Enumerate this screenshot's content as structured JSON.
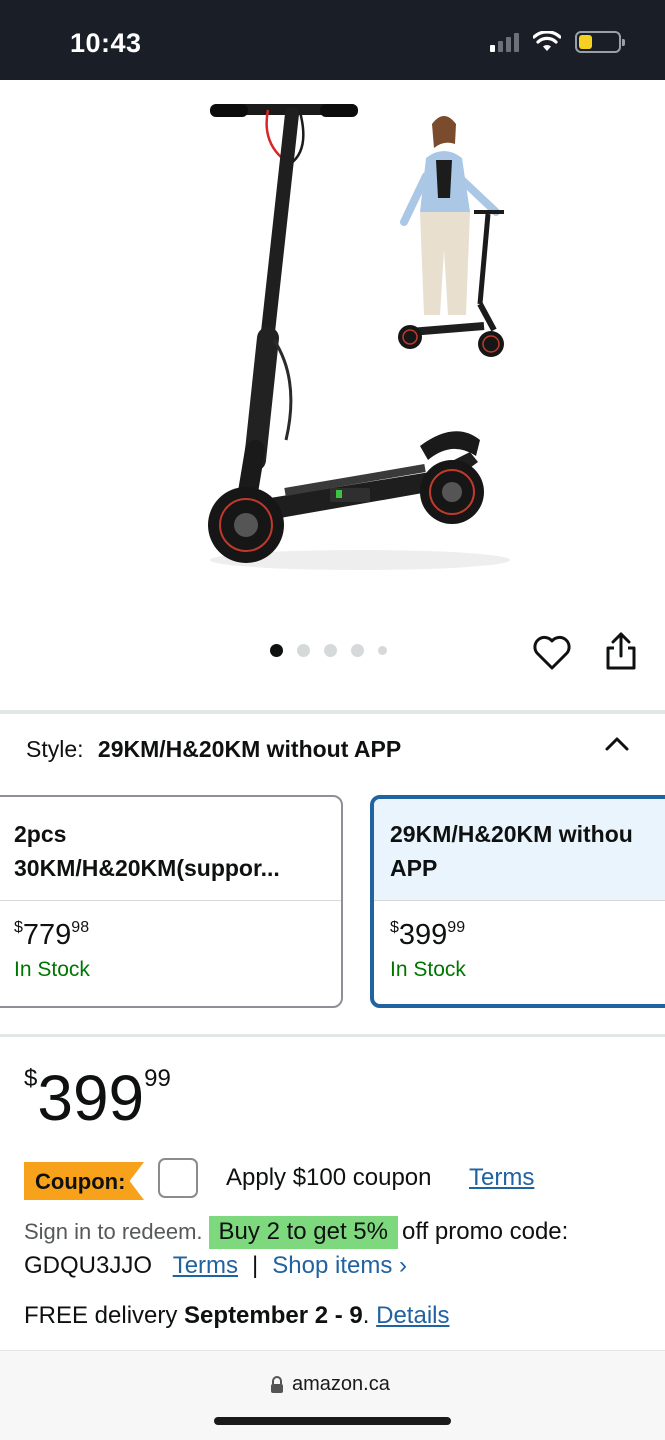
{
  "status_bar": {
    "time": "10:43",
    "icons": [
      "cellular-signal-icon",
      "wifi-icon",
      "battery-icon"
    ],
    "battery_level": 0.35,
    "battery_color": "#f5d21f"
  },
  "gallery": {
    "image": "electric-scooter-product-photo",
    "dots_total": 5,
    "active_dot": 1,
    "icons": [
      "heart-icon",
      "share-icon"
    ]
  },
  "style": {
    "label": "Style:",
    "value": "29KM/H&20KM without APP",
    "toggle_icon": "chevron-up-icon"
  },
  "swatches": [
    {
      "title_line1": "2pcs",
      "title_line2": "30KM/H&20KM(suppor...",
      "currency": "$",
      "whole": "779",
      "fraction": "98",
      "stock": "In Stock",
      "selected": false
    },
    {
      "title_line1": "29KM/H&20KM withou",
      "title_line2": "APP",
      "currency": "$",
      "whole": "399",
      "fraction": "99",
      "stock": "In Stock",
      "selected": true
    }
  ],
  "price": {
    "currency": "$",
    "whole": "399",
    "fraction": "99"
  },
  "coupon": {
    "badge": "Coupon:",
    "apply_text": "Apply $100 coupon",
    "terms": "Terms"
  },
  "promo": {
    "sign_in": "Sign in to redeem.",
    "highlight": "Buy 2 to get 5%",
    "rest": "off promo code:",
    "code": "GDQU3JJO",
    "terms": "Terms",
    "separator": "|",
    "shop_items": "Shop items ›"
  },
  "delivery": {
    "prefix": "FREE delivery",
    "dates": "September 2 - 9",
    "dot": ".",
    "details": "Details"
  },
  "browser": {
    "url": "amazon.ca",
    "lock_icon": "lock-icon"
  },
  "colors": {
    "link": "#2162a1",
    "in_stock": "#007600",
    "coupon_badge": "#f7a21a",
    "promo_highlight": "#7ed97e",
    "selected_border": "#2162a1"
  }
}
